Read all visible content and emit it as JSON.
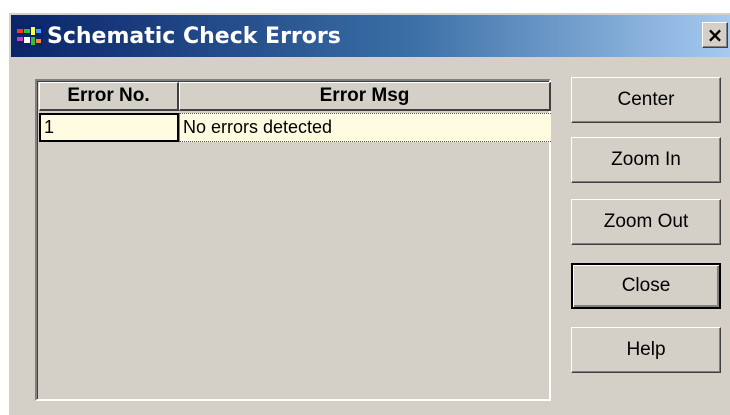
{
  "window": {
    "title": "Schematic Check Errors",
    "close_label": "×"
  },
  "grid": {
    "columns": [
      "Error No.",
      "Error Msg"
    ],
    "rows": [
      {
        "error_no": "1",
        "error_msg": "No errors detected"
      }
    ]
  },
  "buttons": {
    "center": "Center",
    "zoom_in": "Zoom In",
    "zoom_out": "Zoom Out",
    "close": "Close",
    "help": "Help"
  },
  "colors": {
    "titlebar_start": "#0a246a",
    "titlebar_end": "#a6caf0",
    "face": "#d4d0c8",
    "row_highlight": "#fffbe0"
  }
}
